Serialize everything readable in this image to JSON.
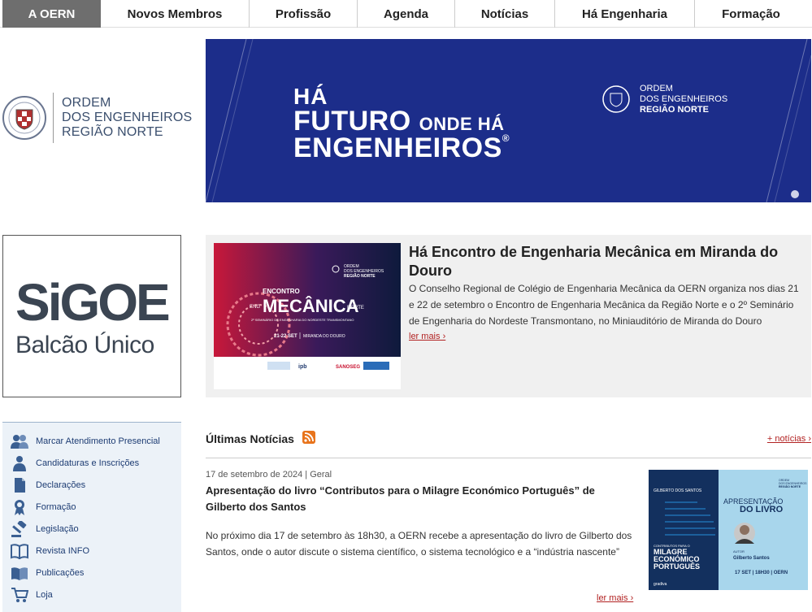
{
  "nav": {
    "items": [
      {
        "label": "A OERN",
        "active": true
      },
      {
        "label": "Novos Membros"
      },
      {
        "label": "Profissão"
      },
      {
        "label": "Agenda"
      },
      {
        "label": "Notícias"
      },
      {
        "label": "Há Engenharia"
      },
      {
        "label": "Formação"
      }
    ]
  },
  "logo": {
    "line1": "ORDEM",
    "line2": "DOS ENGENHEIROS",
    "line3": "REGIÃO NORTE"
  },
  "banner": {
    "line1": "HÁ",
    "line2_big": "FUTURO",
    "line2_small": "ONDE HÁ",
    "line3": "ENGENHEIROS",
    "reg": "®",
    "logo_line1": "ORDEM",
    "logo_line2": "DOS ENGENHEIROS",
    "logo_line3": "REGIÃO NORTE",
    "colors": {
      "bg": "#1c2d8a"
    }
  },
  "sigoe": {
    "title": "SiGOE",
    "subtitle": "Balcão Único"
  },
  "feature": {
    "image_texts": {
      "org1": "ORDEM",
      "org2": "DOS ENGENHEIROS",
      "org3": "REGIÃO NORTE",
      "encontro": "ENCONTRO",
      "eng": "ENG",
      "mecanica": "MECÂNICA",
      "norte": "NORTE",
      "seminario": "2º SEMINÁRIO DE ENGENHARIA DO NORDESTE TRANSMONTANO",
      "date": "21-22 SET",
      "place": "MIRANDA DO DOURO",
      "sponsor_ipb": "ipb",
      "sponsor_sanoseg": "SANOSEG"
    },
    "title": "Há Encontro de Engenharia Mecânica em Miranda do Douro",
    "description": "O Conselho Regional de Colégio de Engenharia Mecânica da OERN organiza nos dias 21 e 22 de setembro o Encontro de Engenharia Mecânica da Região Norte e o 2º Seminário de Engenharia do Nordeste Transmontano, no Miniauditório de Miranda do Douro",
    "read_more": "ler mais"
  },
  "sidebar": {
    "items": [
      {
        "label": "Marcar Atendimento Presencial",
        "icon": "people-icon"
      },
      {
        "label": "Candidaturas e Inscrições",
        "icon": "person-icon"
      },
      {
        "label": "Declarações",
        "icon": "document-icon"
      },
      {
        "label": "Formação",
        "icon": "ribbon-icon"
      },
      {
        "label": "Legislação",
        "icon": "gavel-icon"
      },
      {
        "label": "Revista INFO",
        "icon": "book-icon"
      },
      {
        "label": "Publicações",
        "icon": "open-book-icon"
      },
      {
        "label": "Loja",
        "icon": "cart-icon"
      }
    ]
  },
  "news": {
    "heading": "Últimas Notícias",
    "more": "+ notícias",
    "article": {
      "meta": "17 de setembro de 2024 | Geral",
      "title": "Apresentação do livro “Contributos para o Milagre Económico Português” de Gilberto dos Santos",
      "description": "No próximo dia 17 de setembro às 18h30, a OERN recebe a apresentação do livro de Gilberto dos Santos, onde o autor discute o sistema científico, o sistema tecnológico e a “indústria nascente”",
      "read_more": "ler mais",
      "image_texts": {
        "author_top": "GILBERTO DOS SANTOS",
        "org1": "ORDEM",
        "org2": "DOS ENGENHEIROS",
        "org3": "REGIÃO NORTE",
        "apresentacao": "APRESENTAÇÃO",
        "do_livro": "DO LIVRO",
        "book1": "CONTRIBUTOS PARA O",
        "book2": "MILAGRE",
        "book3": "ECONÓMICO",
        "book4": "PORTUGUÊS",
        "autor_label": "AUTOR",
        "autor_name": "Gilberto Santos",
        "event": "17 SET | 18H30 | OERN",
        "publisher": "gradiva"
      }
    }
  }
}
